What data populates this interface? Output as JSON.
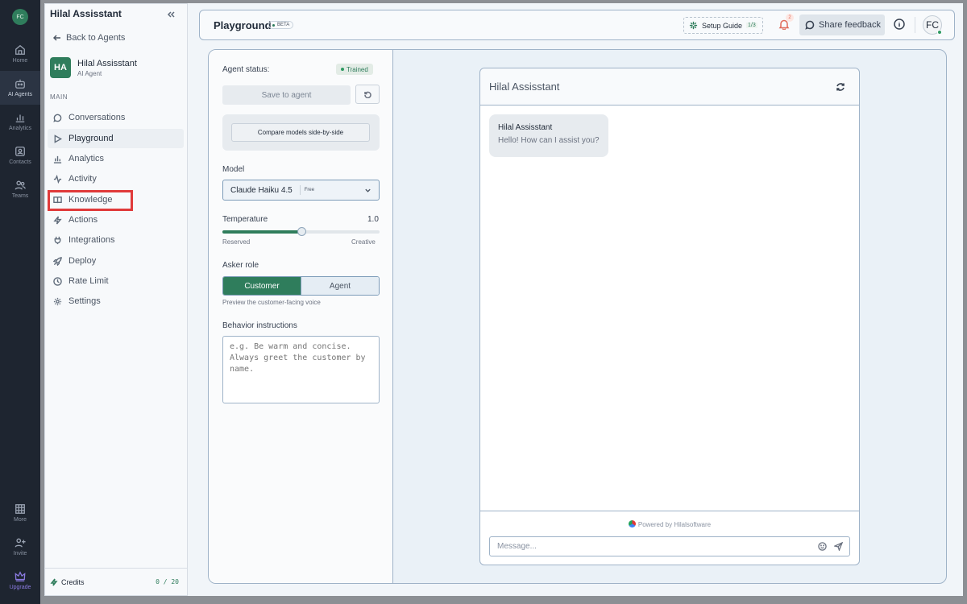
{
  "rail": {
    "avatar": "FC",
    "items": [
      {
        "label": "Home",
        "icon": "home-icon"
      },
      {
        "label": "AI Agents",
        "icon": "robot-icon",
        "active": true
      },
      {
        "label": "Analytics",
        "icon": "chart-icon"
      },
      {
        "label": "Contacts",
        "icon": "contacts-icon"
      },
      {
        "label": "Teams",
        "icon": "users-icon"
      }
    ],
    "bottom": [
      {
        "label": "More",
        "icon": "grid-icon"
      },
      {
        "label": "Invite",
        "icon": "user-plus-icon"
      },
      {
        "label": "Upgrade",
        "icon": "crown-icon"
      }
    ]
  },
  "sidebar": {
    "title": "Hilal Assisstant",
    "back": "Back to Agents",
    "agent": {
      "initials": "HA",
      "name": "Hilal Assisstant",
      "type": "AI Agent"
    },
    "section": "MAIN",
    "items": [
      {
        "label": "Conversations",
        "icon": "chat-bubble-icon"
      },
      {
        "label": "Playground",
        "icon": "play-icon",
        "active": true
      },
      {
        "label": "Analytics",
        "icon": "bar-chart-icon"
      },
      {
        "label": "Activity",
        "icon": "activity-icon"
      },
      {
        "label": "Knowledge",
        "icon": "book-icon"
      },
      {
        "label": "Actions",
        "icon": "bolt-icon"
      },
      {
        "label": "Integrations",
        "icon": "plug-icon"
      },
      {
        "label": "Deploy",
        "icon": "rocket-icon"
      },
      {
        "label": "Rate Limit",
        "icon": "clock-icon"
      },
      {
        "label": "Settings",
        "icon": "gear-icon"
      }
    ],
    "credits_label": "Credits",
    "credits_count": "0 / 20"
  },
  "header": {
    "title": "Playground",
    "badge": "BETA",
    "setup_label": "Setup Guide",
    "setup_progress": "1/3",
    "notifications": "2",
    "share_label": "Share feedback",
    "user_initials": "FC"
  },
  "settings": {
    "status_label": "Agent status:",
    "status_value": "Trained",
    "save_label": "Save to agent",
    "compare_label": "Compare models side-by-side",
    "model_label": "Model",
    "model_value": "Claude Haiku 4.5",
    "model_tier": "Free",
    "temperature_label": "Temperature",
    "temperature_value": "1.0",
    "temperature_fraction": 0.5,
    "temp_min_label": "Reserved",
    "temp_max_label": "Creative",
    "asker_label": "Asker role",
    "asker_options": [
      "Customer",
      "Agent"
    ],
    "asker_selected": "Customer",
    "asker_hint": "Preview the customer-facing voice",
    "behavior_label": "Behavior instructions",
    "behavior_placeholder": "e.g. Be warm and concise. Always greet the customer by name."
  },
  "chat": {
    "title": "Hilal Assisstant",
    "bubble_name": "Hilal Assisstant",
    "bubble_message": "Hello! How can I assist you?",
    "powered": "Powered by Hilalsoftware",
    "input_placeholder": "Message..."
  },
  "colors": {
    "accent": "#2f7d5c",
    "highlight": "#e03a3a"
  }
}
